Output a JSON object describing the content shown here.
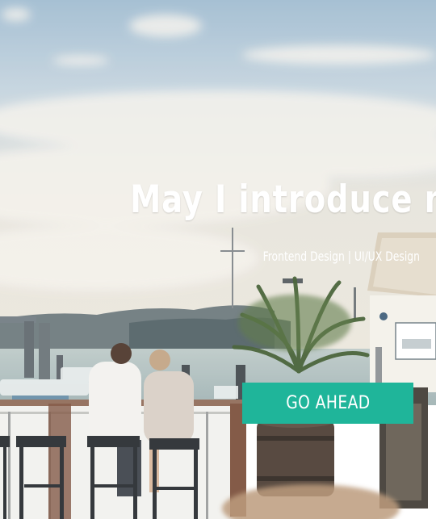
{
  "hero": {
    "headline": "May I introduce my",
    "subline": "Frontend Design | UI/UX Design",
    "cta_label": "GO AHEAD"
  },
  "colors": {
    "text": "#ffffff",
    "cta_background": "#1fb59a",
    "cta_text": "#ffffff",
    "sky_top": "#a9c3d6",
    "sky_bottom": "#e9e6df"
  }
}
